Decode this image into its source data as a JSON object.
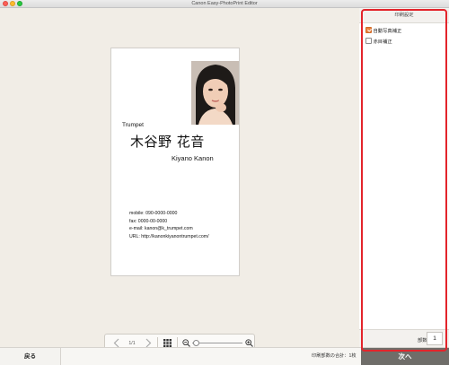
{
  "window": {
    "title": "Canon Easy-PhotoPrint Editor"
  },
  "card": {
    "company": "Trumpet",
    "name_jp": "木谷野 花音",
    "name_en": "Kiyano Kanon",
    "contacts": [
      "mobile: 090-0000-0000",
      "fax: 0000-00-0000",
      "e-mail: kanon@k_trumpet.com",
      "URL: http://kanonkiyanontrumpet.com/"
    ]
  },
  "viewer": {
    "page": "1/1",
    "zoom_level": 0.05
  },
  "panel": {
    "header": "印刷設定",
    "options": [
      {
        "label": "自動写真補正",
        "checked": true
      },
      {
        "label": "赤目補正",
        "checked": false
      }
    ],
    "copies_label": "部数",
    "copies_value": "1"
  },
  "footer": {
    "back_label": "戻る",
    "total_label": "印刷部数の合計：1枚",
    "next_label": "次へ"
  },
  "colors": {
    "accent": "#e9823e",
    "highlight_frame": "#e3242b",
    "next_button": "#6f6d69"
  }
}
